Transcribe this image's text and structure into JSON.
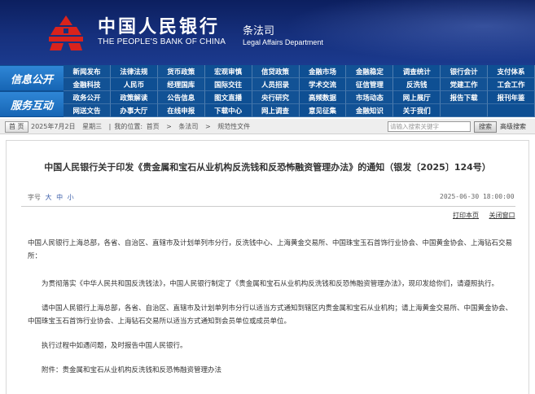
{
  "header": {
    "bank_name_cn": "中国人民银行",
    "bank_name_en": "THE PEOPLE'S BANK OF CHINA",
    "dept_cn": "条法司",
    "dept_en": "Legal Affairs Department",
    "emblem_icon": "pboc-emblem-icon"
  },
  "colors": {
    "banner_blue": "#16307d",
    "nav_blue": "#0e4f93",
    "emblem_red": "#d9231c"
  },
  "nav": {
    "section1_label": "信息公开",
    "section2_label": "服务互动",
    "rows": [
      [
        "新闻发布",
        "法律法规",
        "货币政策",
        "宏观审慎",
        "信贷政策",
        "金融市场",
        "金融稳定",
        "调查统计",
        "银行会计",
        "支付体系"
      ],
      [
        "金融科技",
        "人民币",
        "经理国库",
        "国际交往",
        "人员招录",
        "学术交流",
        "征信管理",
        "反洗钱",
        "党建工作",
        "工会工作"
      ],
      [
        "政务公开",
        "政策解读",
        "公告信息",
        "图文直播",
        "央行研究",
        "高频数据",
        "市场动态",
        "网上展厅",
        "报告下载",
        "报刊年鉴"
      ],
      [
        "网送文告",
        "办事大厅",
        "在线申报",
        "下载中心",
        "网上调查",
        "意见征集",
        "金融知识",
        "关于我们",
        "",
        ""
      ]
    ]
  },
  "breadcrumb": {
    "home_button": "首 页",
    "date": "2025年7月2日",
    "weekday": "星期三",
    "location_label": "我的位置:",
    "trail": [
      "首页",
      "条法司",
      "规范性文件"
    ],
    "separator": ">"
  },
  "search": {
    "placeholder": "请输入搜索关键字",
    "button": "搜索",
    "advanced": "高级搜索"
  },
  "article": {
    "title": "中国人民银行关于印发《贵金属和宝石从业机构反洗钱和反恐怖融资管理办法》的通知（银发〔2025〕124号）",
    "font_size_label": "字号",
    "font_sizes": [
      "大",
      "中",
      "小"
    ],
    "date": "2025-06-30 18:00:00",
    "print_label": "打印本页",
    "close_label": "关闭窗口",
    "paragraphs": [
      "中国人民银行上海总部，各省、自治区、直辖市及计划单列市分行，反洗钱中心、上海黄金交易所、中国珠宝玉石首饰行业协会、中国黄金协会、上海钻石交易所：",
      "为贯彻落实《中华人民共和国反洗钱法》，中国人民银行制定了《贵金属和宝石从业机构反洗钱和反恐怖融资管理办法》，现印发给你们，请遵照执行。",
      "请中国人民银行上海总部，各省、自治区、直辖市及计划单列市分行以适当方式通知到辖区内贵金属和宝石从业机构；请上海黄金交易所、中国黄金协会、中国珠宝玉石首饰行业协会、上海钻石交易所以适当方式通知到会员单位或成员单位。",
      "执行过程中如遇问题，及时报告中国人民银行。",
      "附件：贵金属和宝石从业机构反洗钱和反恐怖融资管理办法"
    ]
  }
}
